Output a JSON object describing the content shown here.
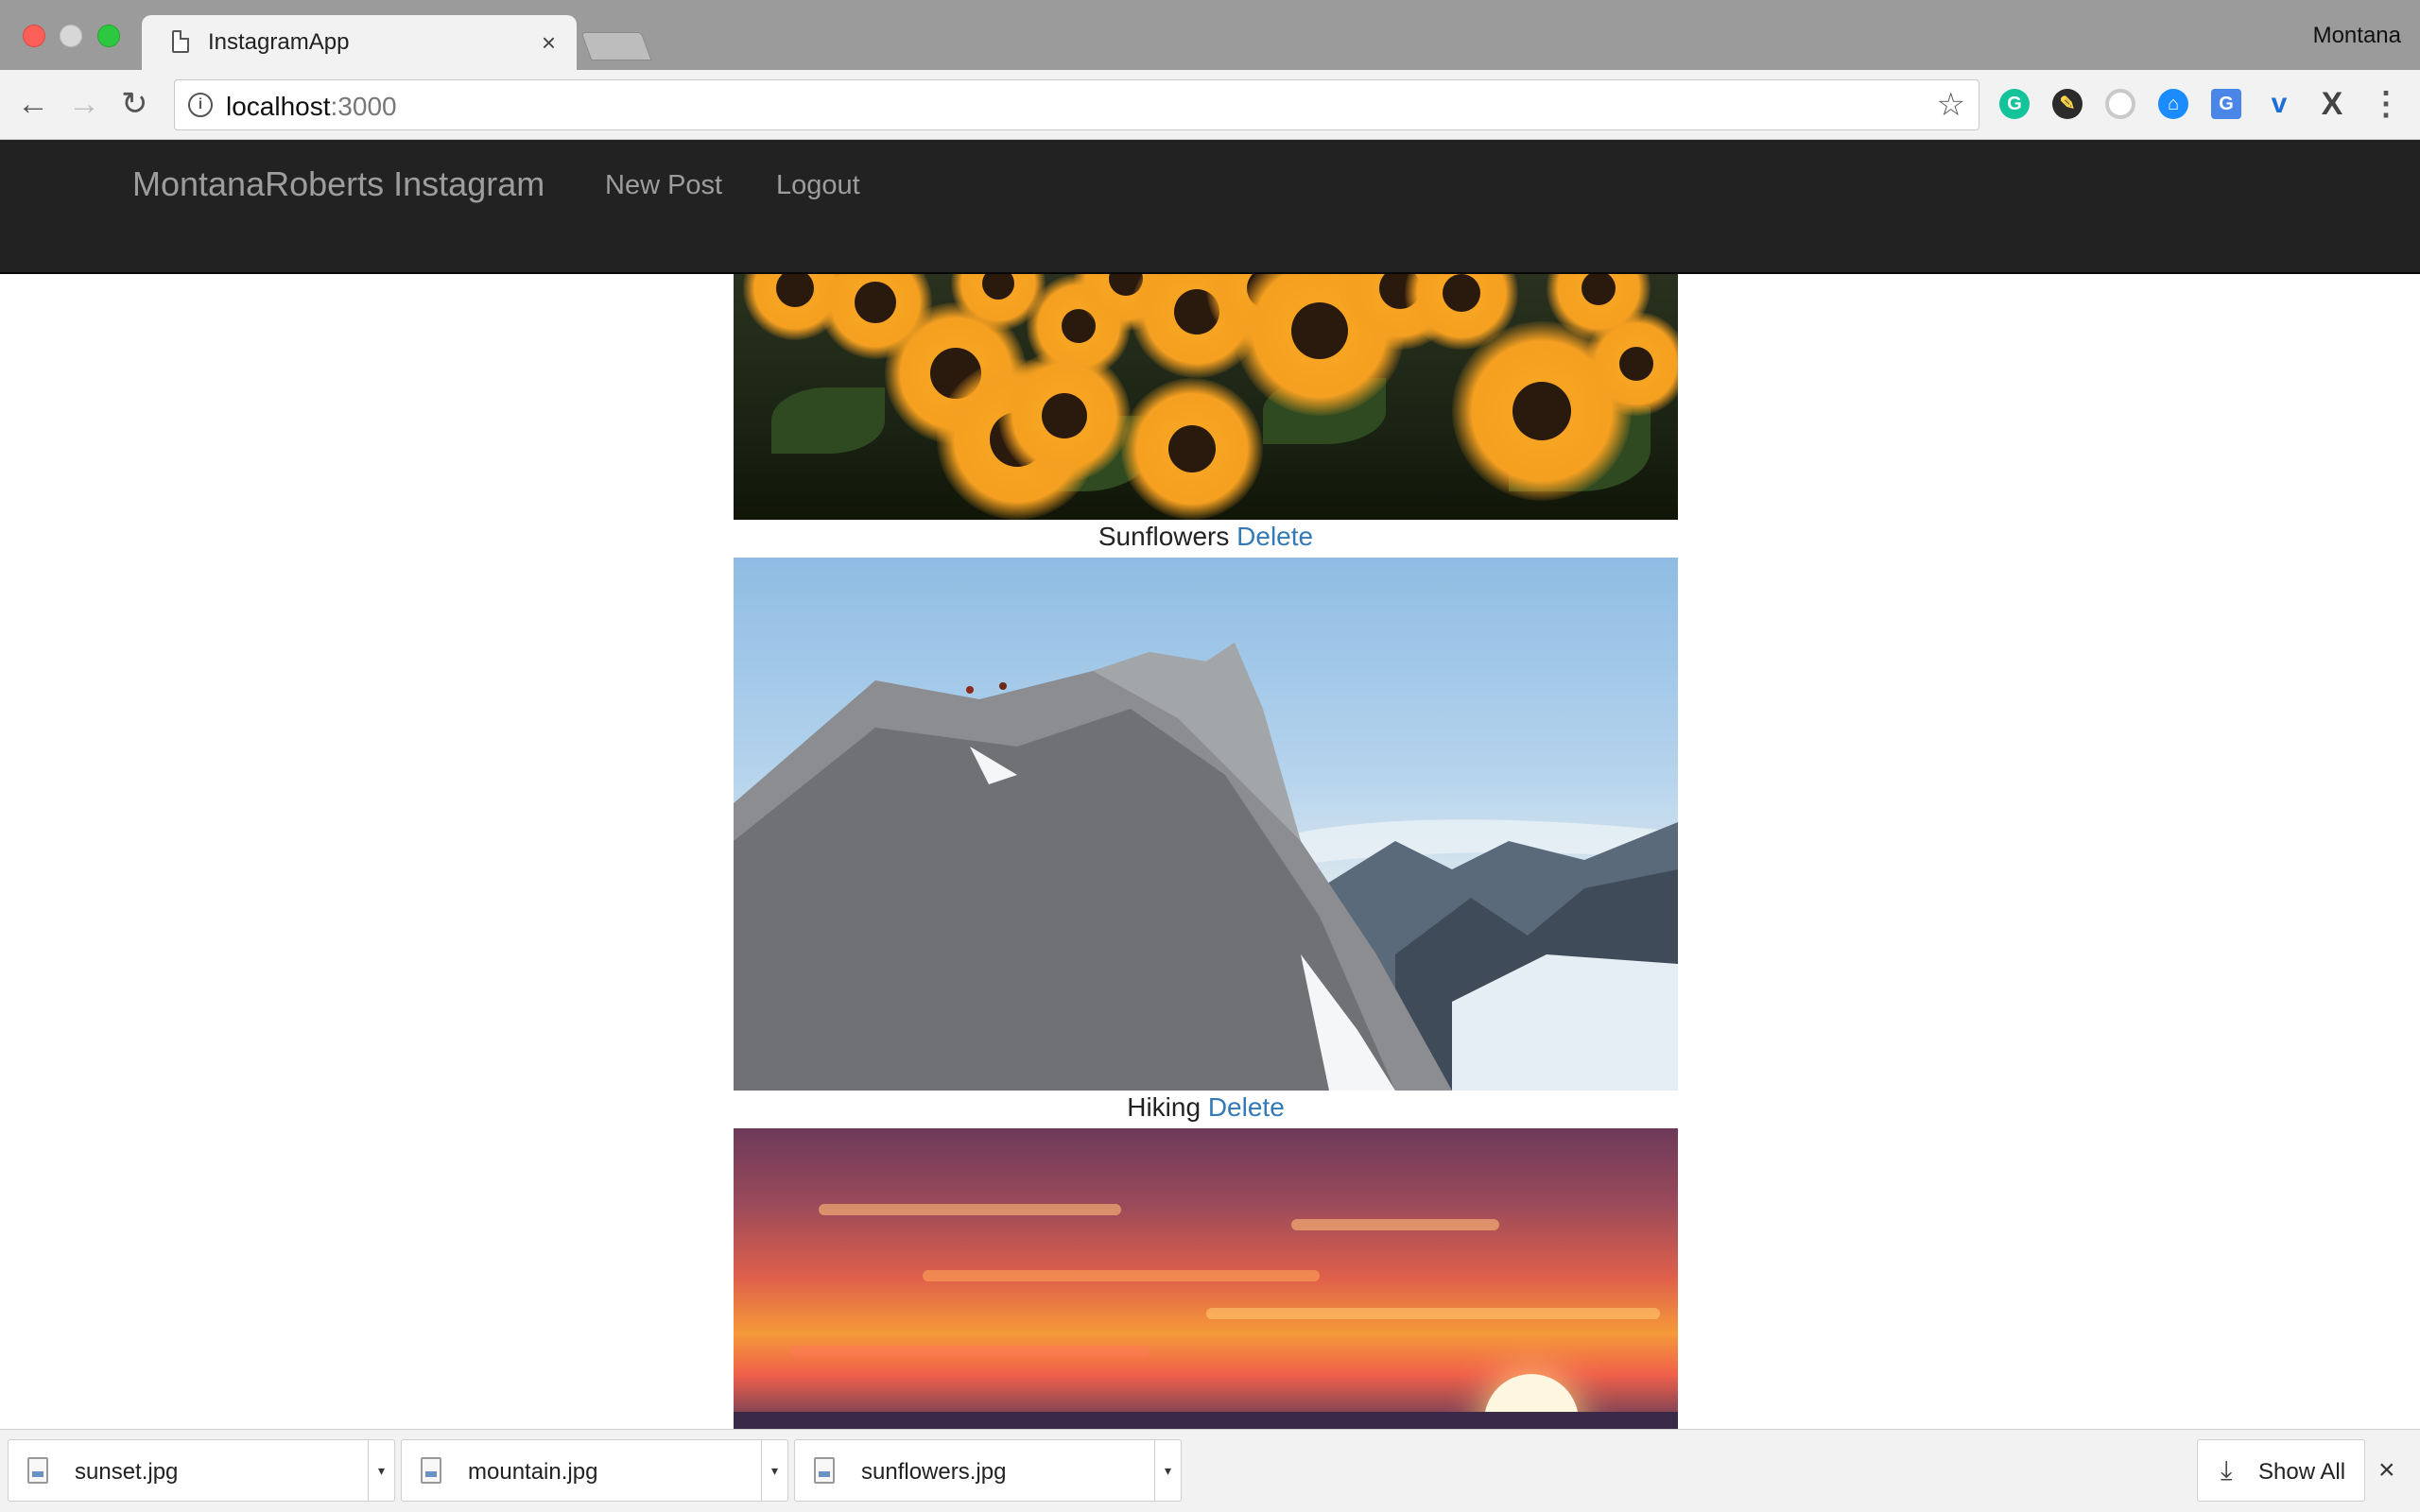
{
  "browser": {
    "tab_title": "InstagramApp",
    "tab_close": "×",
    "profile_name": "Montana",
    "url_host": "localhost",
    "url_port": ":3000",
    "back_glyph": "←",
    "forward_glyph": "→",
    "reload_glyph": "↻",
    "info_glyph": "i",
    "star_glyph": "☆",
    "menu_glyph": "⋮",
    "extensions": [
      "grammarly-icon",
      "pen-icon",
      "ring-icon",
      "bank-icon",
      "translate-icon",
      "v-icon",
      "x-icon"
    ]
  },
  "navbar": {
    "brand": "MontanaRoberts Instagram",
    "links": [
      "New Post",
      "Logout"
    ]
  },
  "posts": [
    {
      "caption": "Sunflowers",
      "action": "Delete",
      "image": "sunflowers"
    },
    {
      "caption": "Hiking",
      "action": "Delete",
      "image": "mountain"
    },
    {
      "caption": "",
      "action": "",
      "image": "sunset"
    }
  ],
  "downloads": {
    "items": [
      "sunset.jpg",
      "mountain.jpg",
      "sunflowers.jpg"
    ],
    "show_all": "Show All",
    "close_glyph": "×"
  },
  "colors": {
    "navbar_bg": "#222222",
    "navbar_text": "#9d9d9d",
    "link": "#337ab7"
  }
}
